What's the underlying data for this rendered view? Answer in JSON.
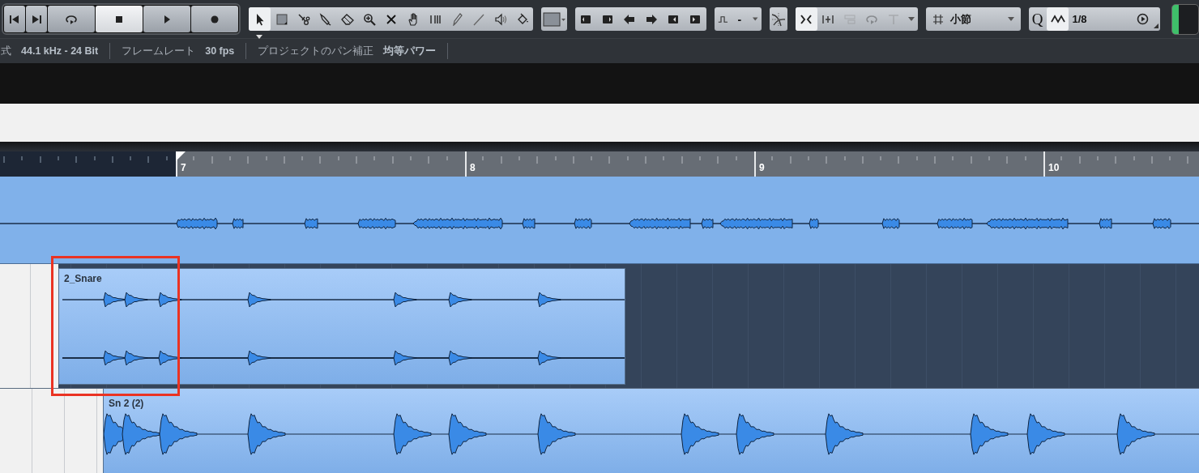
{
  "transport": [
    {
      "kind": "to-start",
      "active": false
    },
    {
      "kind": "to-end",
      "active": false
    },
    {
      "kind": "cycle",
      "active": false
    },
    {
      "kind": "stop",
      "active": true
    },
    {
      "kind": "play",
      "active": false
    },
    {
      "kind": "record",
      "active": false
    }
  ],
  "tools": [
    {
      "kind": "arrow",
      "selected": true
    },
    {
      "kind": "range",
      "selected": false
    },
    {
      "kind": "scissors",
      "selected": false
    },
    {
      "kind": "glue",
      "selected": false
    },
    {
      "kind": "eraser",
      "selected": false
    },
    {
      "kind": "zoom",
      "selected": false
    },
    {
      "kind": "mute",
      "selected": false
    },
    {
      "kind": "hand",
      "selected": false
    },
    {
      "kind": "comp",
      "selected": false
    },
    {
      "kind": "pencil",
      "selected": false
    },
    {
      "kind": "line",
      "selected": false
    },
    {
      "kind": "speaker",
      "selected": false
    },
    {
      "kind": "paint",
      "selected": false
    }
  ],
  "nudge": [
    {
      "kind": "trim-left"
    },
    {
      "kind": "trim-right"
    },
    {
      "kind": "move-left"
    },
    {
      "kind": "move-right"
    },
    {
      "kind": "shrink-left"
    },
    {
      "kind": "shrink-right"
    }
  ],
  "fade_mode": {
    "value": "-"
  },
  "snap_toggles": [
    {
      "kind": "snap",
      "selected": true,
      "disabled": false
    },
    {
      "kind": "grid",
      "selected": false,
      "disabled": false
    },
    {
      "kind": "shuffle",
      "selected": false,
      "disabled": true
    },
    {
      "kind": "cycle",
      "selected": false,
      "disabled": true
    },
    {
      "kind": "cursor",
      "selected": false,
      "disabled": true
    }
  ],
  "snap_type": {
    "value": "小節"
  },
  "quantize": {
    "label": "Q",
    "value": "1/8"
  },
  "info_bar": [
    {
      "label": "式",
      "value": "44.1 kHz - 24 Bit"
    },
    {
      "label": "フレームレート",
      "value": "30 fps"
    },
    {
      "label": "プロジェクトのパン補正",
      "value": "均等パワー"
    }
  ],
  "ruler": {
    "bars": [
      "7",
      "8",
      "9",
      "10"
    ]
  },
  "tracks": [
    {
      "kind": "full"
    },
    {
      "kind": "stereo",
      "name": "2_Snare"
    },
    {
      "kind": "hits",
      "name": "Sn 2 (2)"
    }
  ]
}
